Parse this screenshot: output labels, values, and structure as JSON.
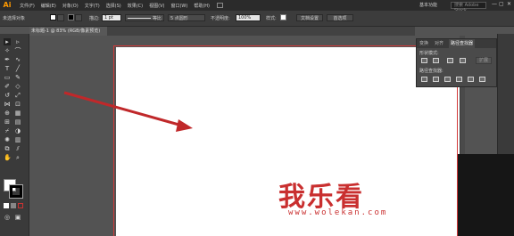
{
  "app": {
    "logo": "Ai"
  },
  "menubar": {
    "items": [
      "文件(F)",
      "编辑(E)",
      "对象(O)",
      "文字(T)",
      "选择(S)",
      "效果(C)",
      "视图(V)",
      "窗口(W)",
      "帮助(H)"
    ],
    "workspace": "基本功能",
    "search_placeholder": "搜索 Adobe Stock",
    "win_controls": [
      "—",
      "▢",
      "✕"
    ]
  },
  "controlbar": {
    "selection": "未选择对象",
    "stroke_label": "描边:",
    "stroke_value": "1 pt",
    "stroke_style": "等比",
    "brush": "5 点圆形",
    "opacity_label": "不透明度:",
    "opacity_value": "100%",
    "style_label": "样式:",
    "doc_setup": "文档设置",
    "prefs": "首选项"
  },
  "document": {
    "tab_title": "未标题-1 @ 83% (RGB/像素预览)"
  },
  "pathfinder_panel": {
    "tabs": [
      "变换",
      "对齐",
      "路径查找器"
    ],
    "shape_modes_label": "形状模式:",
    "pathfinders_label": "路径查找器:",
    "expand_label": "扩展"
  },
  "watermark": {
    "text": "我乐看",
    "url": "www.wolekan.com"
  },
  "annotation": {
    "arrow_color": "#c0282a"
  }
}
